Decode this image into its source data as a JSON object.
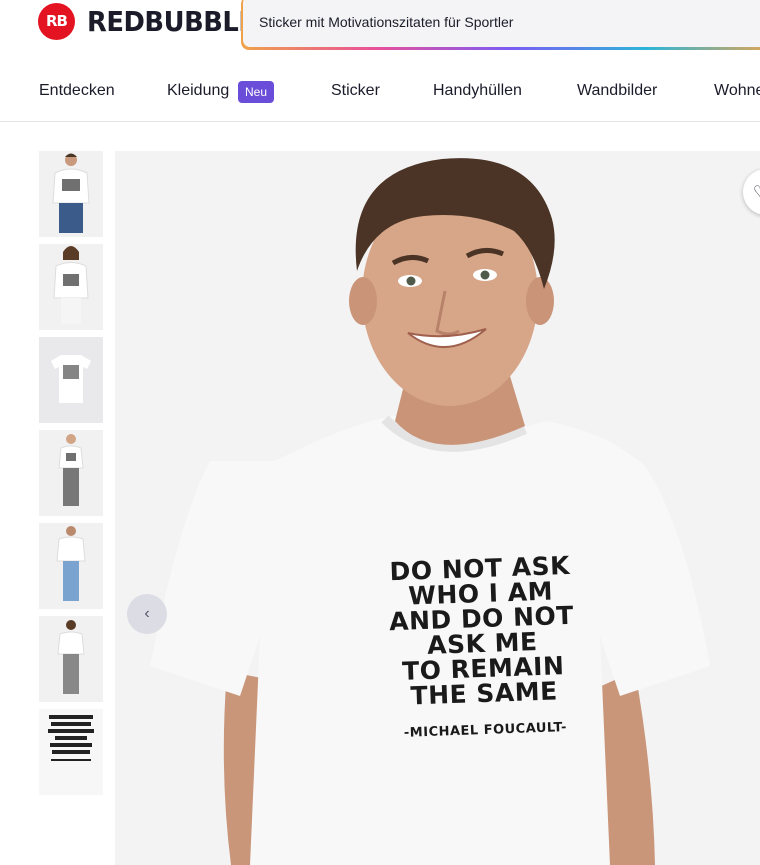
{
  "brand": {
    "logo_mark": "RB",
    "name": "REDBUBBLE",
    "color": "#e41321"
  },
  "search": {
    "value": "Sticker mit Motivationszitaten für Sportler"
  },
  "nav": {
    "items": [
      {
        "label": "Entdecken"
      },
      {
        "label": "Kleidung",
        "badge": "Neu"
      },
      {
        "label": "Sticker"
      },
      {
        "label": "Handyhüllen"
      },
      {
        "label": "Wandbilder"
      },
      {
        "label": "Wohnen"
      }
    ],
    "badge_color": "#6a4dd8"
  },
  "product": {
    "quote_lines": [
      "DO NOT ASK",
      "WHO I AM",
      "AND DO NOT",
      "ASK ME",
      "TO REMAIN",
      "THE SAME"
    ],
    "author": "-MICHAEL FOUCAULT-",
    "thumbnail_count": 7
  },
  "icons": {
    "prev": "chevron-left-icon",
    "favorite": "heart-icon"
  }
}
